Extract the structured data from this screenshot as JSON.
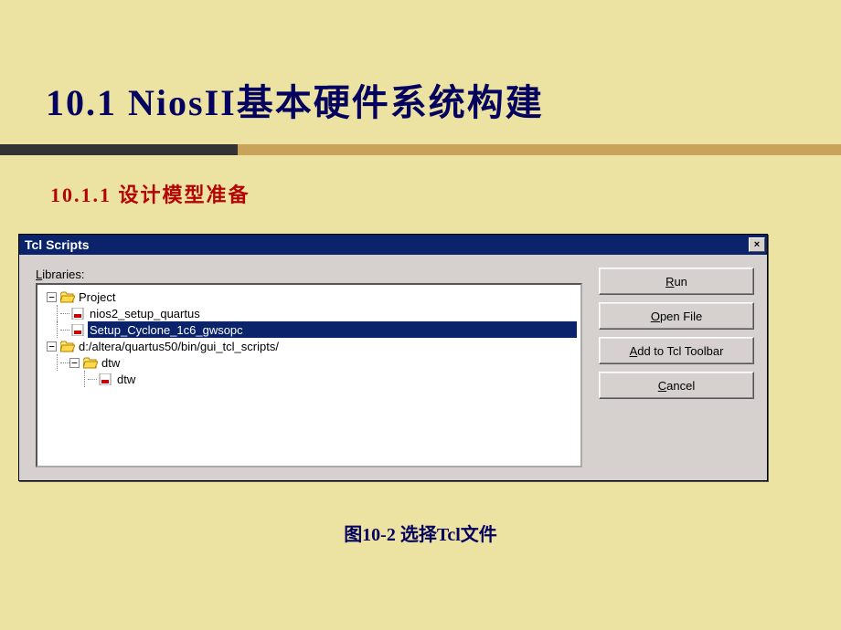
{
  "slide": {
    "title": "10.1  NiosII基本硬件系统构建",
    "subtitle": "10.1.1  设计模型准备",
    "caption": "图10-2 选择Tcl文件"
  },
  "dialog": {
    "title": "Tcl Scripts",
    "close": "×",
    "libraries_label_pre": "L",
    "libraries_label_rest": "ibraries:",
    "buttons": {
      "run_pre": "R",
      "run_rest": "un",
      "open_pre": "O",
      "open_rest": "pen File",
      "add_pre": "A",
      "add_rest": "dd to Tcl Toolbar",
      "cancel_pre": "C",
      "cancel_rest": "ancel"
    },
    "tree": {
      "project_label": "Project",
      "item1": "nios2_setup_quartus",
      "item2_selected": "Setup_Cyclone_1c6_gwsopc",
      "path_label": "d:/altera/quartus50/bin/gui_tcl_scripts/",
      "dtw_folder": "dtw",
      "dtw_item": "dtw"
    }
  }
}
